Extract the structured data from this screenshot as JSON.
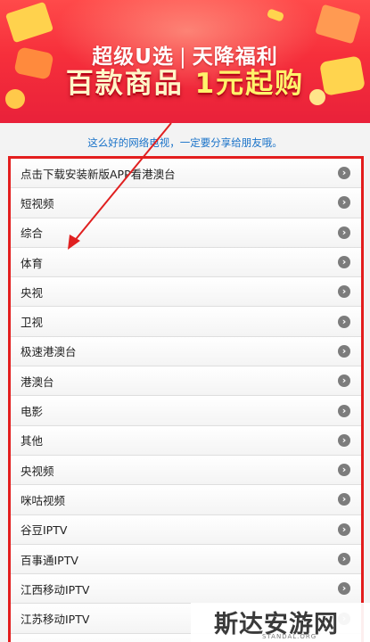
{
  "banner": {
    "brand": "超级U选",
    "separator": "|",
    "slogan": "天降福利",
    "headline_main": "百款商品",
    "headline_accent": "1元起购"
  },
  "share_text": "这么好的网络电视，一定要分享给朋友哦。",
  "channels": [
    {
      "label": "点击下载安装新版APP看港澳台"
    },
    {
      "label": "短视频"
    },
    {
      "label": "综合"
    },
    {
      "label": "体育"
    },
    {
      "label": "央视"
    },
    {
      "label": "卫视"
    },
    {
      "label": "极速港澳台"
    },
    {
      "label": "港澳台"
    },
    {
      "label": "电影"
    },
    {
      "label": "其他"
    },
    {
      "label": "央视频"
    },
    {
      "label": "咪咕视频"
    },
    {
      "label": "谷豆IPTV"
    },
    {
      "label": "百事通IPTV"
    },
    {
      "label": "江西移动IPTV"
    },
    {
      "label": "江苏移动IPTV"
    },
    {
      "label": ""
    }
  ],
  "chevron_icon": "chevron-right-circle-icon",
  "annotation": {
    "color": "#e02020",
    "icon": "arrow-annotation"
  },
  "watermark": {
    "name": "斯达安游网",
    "domain": "STANDAL.ORG"
  },
  "colors": {
    "frame": "#e31d1d",
    "share_text": "#1a73c9",
    "banner": "#f62f3b"
  }
}
